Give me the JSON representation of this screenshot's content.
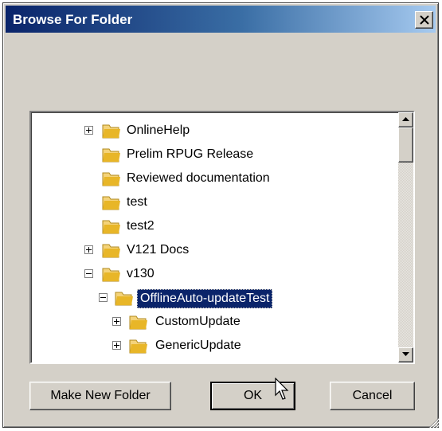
{
  "window": {
    "title": "Browse For Folder",
    "close_label": "Close"
  },
  "tree": {
    "items": [
      {
        "label": "OnlineHelp",
        "expander": "plus"
      },
      {
        "label": "Prelim RPUG Release",
        "expander": "none"
      },
      {
        "label": "Reviewed documentation",
        "expander": "none"
      },
      {
        "label": "test",
        "expander": "none"
      },
      {
        "label": "test2",
        "expander": "none"
      },
      {
        "label": "V121 Docs",
        "expander": "plus"
      },
      {
        "label": "v130",
        "expander": "minus"
      },
      {
        "label": "OfflineAuto-updateTest",
        "expander": "minus",
        "selected": true
      },
      {
        "label": "CustomUpdate",
        "expander": "plus"
      },
      {
        "label": "GenericUpdate",
        "expander": "plus"
      }
    ]
  },
  "buttons": {
    "make_new_folder": "Make New Folder",
    "ok": "OK",
    "cancel": "Cancel"
  },
  "colors": {
    "dialog_bg": "#d4d0c8",
    "title_start": "#0a246a",
    "title_end": "#a6caf0",
    "selection": "#0a246a",
    "folder": "#e8b628"
  }
}
